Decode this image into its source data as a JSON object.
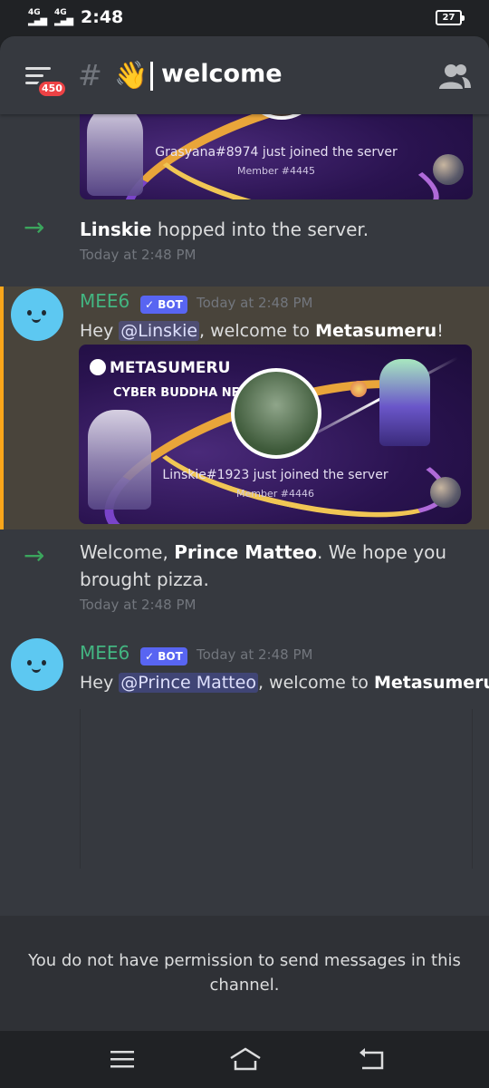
{
  "status_bar": {
    "sim1": "4G",
    "sim2": "4G",
    "time": "2:48",
    "battery": "27"
  },
  "header": {
    "unread_badge": "450",
    "hash_symbol": "#",
    "channel_emoji": "👋",
    "channel_name": "welcome",
    "icons": {
      "menu": "hamburger-menu-icon",
      "members": "members-icon"
    }
  },
  "messages": [
    {
      "type": "embed_partial",
      "joined_text": "Grasyana#8974 just joined the server",
      "member_number": "Member #4445"
    },
    {
      "type": "system",
      "username": "Linskie",
      "text": " hopped into the server.",
      "timestamp": "Today at 2:48 PM"
    },
    {
      "type": "bot",
      "author": "MEE6",
      "badge": "✓ BOT",
      "timestamp": "Today at 2:48 PM",
      "text_prefix": "Hey ",
      "mention": "@Linskie",
      "text_middle": ", welcome to ",
      "server_name": "Metasumeru",
      "text_suffix": "!",
      "embed": {
        "brand": "METASUMERU",
        "subtitle": "CYBER BUDDHA NFT",
        "joined_text": "Linskie#1923 just joined the server",
        "member_number": "Member #4446"
      }
    },
    {
      "type": "system",
      "text_prefix": "Welcome, ",
      "username": "Prince Matteo",
      "text": ". We hope you brought pizza.",
      "timestamp": "Today at 2:48 PM"
    },
    {
      "type": "bot",
      "author": "MEE6",
      "badge": "✓ BOT",
      "timestamp": "Today at 2:48 PM",
      "text_prefix": "Hey ",
      "mention": "@Prince Matteo",
      "text_middle": ", welcome to ",
      "server_name": "Metasumeru",
      "text_suffix": "!"
    }
  ],
  "footer": {
    "permission_text": "You do not have permission to send messages in this channel."
  },
  "nav": {
    "icons": [
      "recent-apps-icon",
      "home-icon",
      "back-icon"
    ]
  },
  "colors": {
    "background": "#36393f",
    "bot_author": "#43b581",
    "bot_badge": "#5865f2",
    "join_arrow": "#3ba55d",
    "highlight_border": "#faa61a",
    "badge_red": "#ed4245"
  }
}
